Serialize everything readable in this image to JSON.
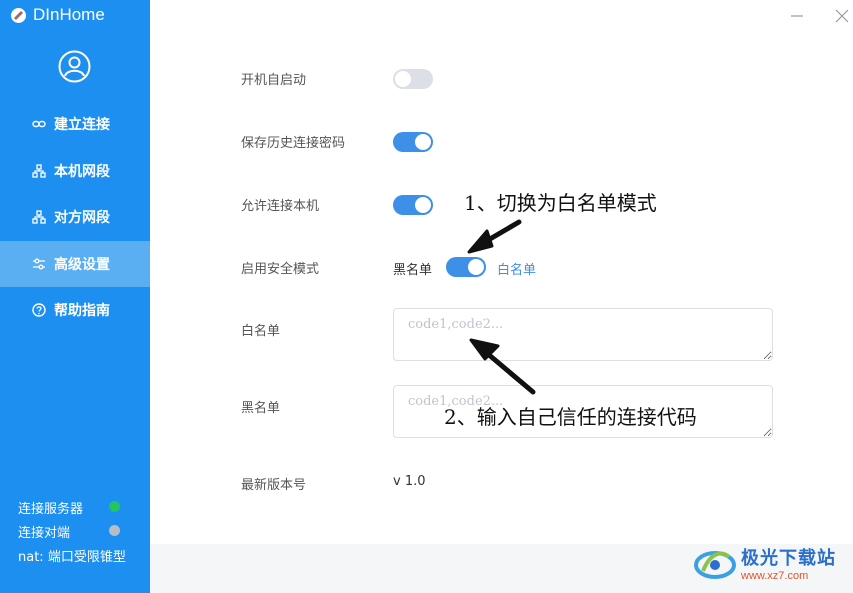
{
  "app": {
    "title": "DInHome"
  },
  "sidebar": {
    "items": [
      {
        "label": "建立连接",
        "icon": "link-icon",
        "active": false
      },
      {
        "label": "本机网段",
        "icon": "network-icon",
        "active": false
      },
      {
        "label": "对方网段",
        "icon": "network-icon",
        "active": false
      },
      {
        "label": "高级设置",
        "icon": "sliders-icon",
        "active": true
      },
      {
        "label": "帮助指南",
        "icon": "help-icon",
        "active": false
      }
    ],
    "status": [
      {
        "label": "连接服务器",
        "color": "#22c55e"
      },
      {
        "label": "连接对端",
        "color": "#b8bcc4"
      },
      {
        "label": "nat: 端口受限锥型"
      }
    ]
  },
  "settings": {
    "autostart": {
      "label": "开机自启动",
      "on": false
    },
    "save_password": {
      "label": "保存历史连接密码",
      "on": true
    },
    "allow_connect": {
      "label": "允许连接本机",
      "on": true
    },
    "security_mode": {
      "label": "启用安全模式",
      "left": "黑名单",
      "right": "白名单",
      "on": true
    },
    "whitelist": {
      "label": "白名单",
      "placeholder": "code1,code2..."
    },
    "blacklist": {
      "label": "黑名单",
      "placeholder": "code1,code2..."
    },
    "version": {
      "label": "最新版本号",
      "value": "v 1.0"
    }
  },
  "annotations": {
    "step1": "1、切换为白名单模式",
    "step2": "2、输入自己信任的连接代码"
  },
  "watermark": {
    "title": "极光下载站",
    "url": "www.xz7.com"
  },
  "colors": {
    "sidebar": "#1c8ff0",
    "accent": "#3d8fe7",
    "active_item": "#5aaef2"
  }
}
